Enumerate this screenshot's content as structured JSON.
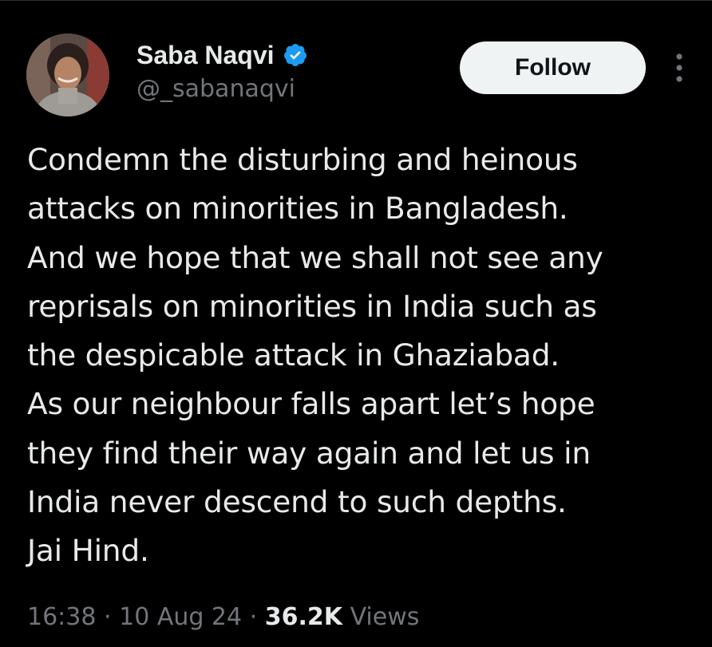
{
  "author": {
    "display_name": "Saba Naqvi",
    "handle": "@_sabanaqvi",
    "verified": true
  },
  "actions": {
    "follow_label": "Follow"
  },
  "tweet": {
    "lines": [
      "Condemn the disturbing and heinous",
      "attacks on minorities in Bangladesh.",
      "And we hope that we shall not see any",
      "reprisals on minorities in India such as",
      "the despicable attack in Ghaziabad.",
      "As our neighbour falls apart let’s hope",
      "they find their way again and let us in",
      "India never descend to such depths.",
      "Jai Hind."
    ]
  },
  "meta": {
    "time": "16:38",
    "separator": "·",
    "date": "10 Aug 24",
    "views_count": "36.2K",
    "views_label": "Views"
  },
  "colors": {
    "background": "#000000",
    "text_primary": "#e7e9ea",
    "text_secondary": "#71767b",
    "verified_blue": "#1d9bf0",
    "follow_bg": "#eff3f4",
    "follow_text": "#0f1419"
  },
  "icons": {
    "verified": "verified-badge-icon",
    "more": "more-vertical-icon"
  }
}
